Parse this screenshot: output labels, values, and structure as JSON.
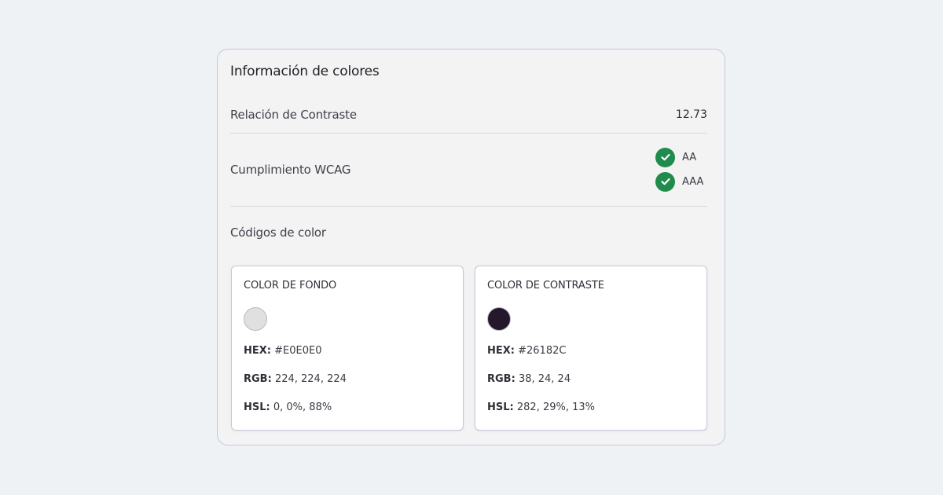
{
  "panel": {
    "title": "Información de colores",
    "contrast": {
      "label": "Relación de Contraste",
      "value": "12.73"
    },
    "wcag": {
      "label": "Cumplimiento WCAG",
      "levels": [
        {
          "label": "AA",
          "passed": true,
          "icon": "check-circle-icon"
        },
        {
          "label": "AAA",
          "passed": true,
          "icon": "check-circle-icon"
        }
      ]
    },
    "codes_title": "Códigos de color",
    "cards": [
      {
        "title": "COLOR DE FONDO",
        "swatch": "#E0E0E0",
        "hex_label": "HEX:",
        "hex": "#E0E0E0",
        "rgb_label": "RGB:",
        "rgb": "224, 224, 224",
        "hsl_label": "HSL:",
        "hsl": "0, 0%, 88%"
      },
      {
        "title": "COLOR DE CONTRASTE",
        "swatch": "#26182C",
        "hex_label": "HEX:",
        "hex": "#26182C",
        "rgb_label": "RGB:",
        "rgb": "38, 24, 24",
        "hsl_label": "HSL:",
        "hsl": "282, 29%, 13%"
      }
    ]
  },
  "colors": {
    "pass_green": "#1f8b4c",
    "page_background": "#eff2f5",
    "panel_background": "#f3f3f4",
    "border": "#c3c8d6"
  }
}
